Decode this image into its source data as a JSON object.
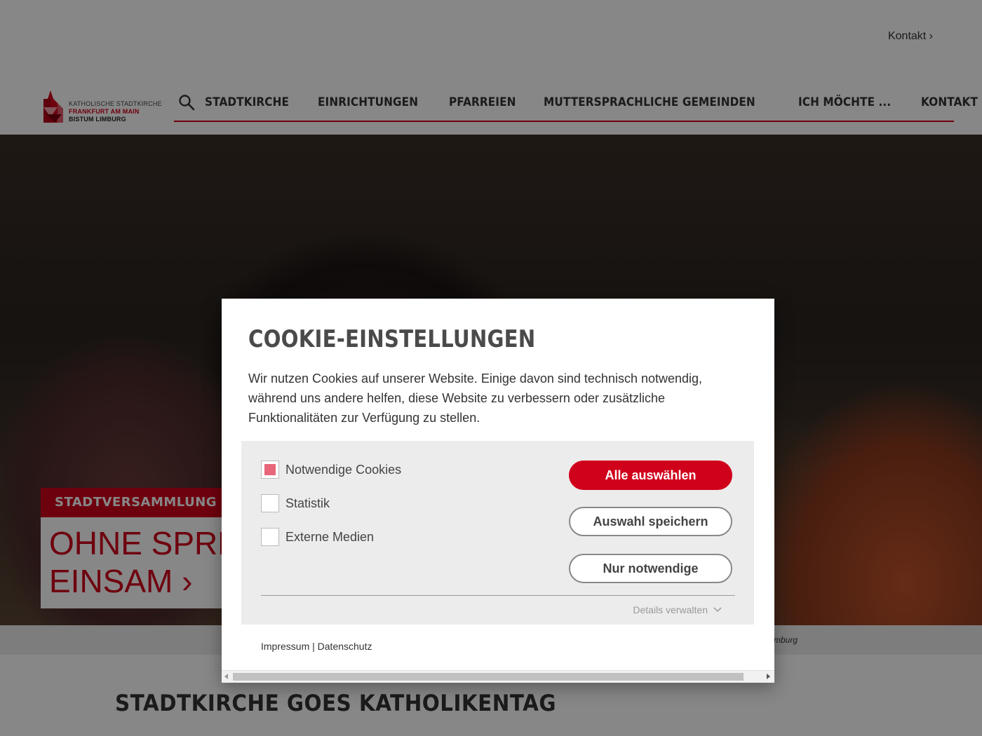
{
  "header": {
    "contact_link": "Kontakt ›",
    "logo": {
      "line1": "KATHOLISCHE STADTKIRCHE",
      "line2": "FRANKFURT AM MAIN",
      "line3": "BISTUM LIMBURG"
    },
    "nav": [
      {
        "label": "STADTKIRCHE"
      },
      {
        "label": "EINRICHTUNGEN"
      },
      {
        "label": "PFARREIEN"
      },
      {
        "label": "MUTTERSPRACHLICHE GEMEINDEN"
      },
      {
        "label": "ICH MÖCHTE ..."
      },
      {
        "label": "KONTAKT"
      }
    ]
  },
  "hero": {
    "tag": "STADTVERSAMMLUNG",
    "headline": "OHNE SPRE\nEINSAM ›",
    "caption": "mburg"
  },
  "section": {
    "title": "STADTKIRCHE GOES KATHOLIKENTAG"
  },
  "cookie_dialog": {
    "title": "COOKIE-EINSTELLUNGEN",
    "text": "Wir nutzen Cookies auf unserer Website. Einige davon sind technisch notwendig, während uns andere helfen, diese Website zu verbessern oder zusätzliche Funktionalitäten zur Verfügung zu stellen.",
    "options": [
      {
        "label": "Notwendige Cookies",
        "checked": true
      },
      {
        "label": "Statistik",
        "checked": false
      },
      {
        "label": "Externe Medien",
        "checked": false
      }
    ],
    "buttons": {
      "select_all": "Alle auswählen",
      "save_selection": "Auswahl speichern",
      "only_necessary": "Nur notwendige"
    },
    "details_label": "Details verwalten",
    "footer": {
      "impressum": "Impressum",
      "separator": " | ",
      "datenschutz": "Datenschutz"
    }
  },
  "colors": {
    "accent": "#d0021b",
    "checked_fill": "#e8667a",
    "panel_bg": "#ececec"
  }
}
